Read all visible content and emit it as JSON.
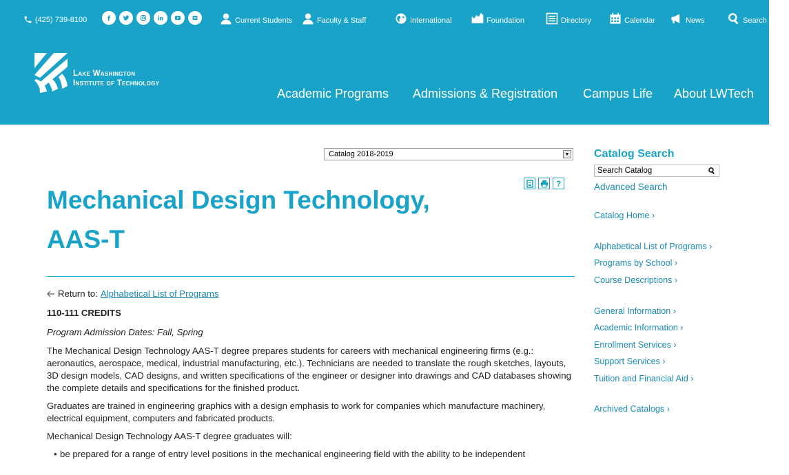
{
  "header": {
    "phone": "(425) 739-8100",
    "socials": [
      "facebook-icon",
      "twitter-icon",
      "instagram-icon",
      "linkedin-icon",
      "youtube-icon",
      "flickr-icon"
    ],
    "top_links": [
      {
        "icon": "person-icon",
        "label": "Current Students"
      },
      {
        "icon": "person-icon",
        "label": "Faculty & Staff"
      },
      {
        "icon": "globe-icon",
        "label": "International"
      },
      {
        "icon": "chart-icon",
        "label": "Foundation"
      },
      {
        "icon": "directory-icon",
        "label": "Directory"
      },
      {
        "icon": "calendar-icon",
        "label": "Calendar"
      },
      {
        "icon": "megaphone-icon",
        "label": "News"
      },
      {
        "icon": "search-icon",
        "label": "Search"
      }
    ],
    "logo_line1": "Lake Washington",
    "logo_line2": "Institute of Technology",
    "main_nav": [
      "Academic Programs",
      "Admissions & Registration",
      "Campus Life",
      "About LWTech"
    ],
    "colors": {
      "brand": "#1aa3c8",
      "link": "#1a8bb5"
    }
  },
  "catalog_select": {
    "value": "Catalog 2018-2019"
  },
  "page": {
    "title_line1": "Mechanical Design Technology,",
    "title_line2": "AAS-T",
    "return_label": "Return to:",
    "return_link": "Alphabetical List of Programs",
    "credits": "110-111 CREDITS",
    "admission_dates": "Program Admission Dates: Fall, Spring",
    "para1": "The Mechanical Design Technology AAS-T degree prepares students for careers with mechanical engineering firms (e.g.: aeronautics, aerospace, medical, industrial manufacturing, etc.). Technicians are needed to translate the rough sketches, layouts, 3D design models, CAD designs, and written specifications of the engineer or designer into drawings and CAD databases showing the complete details and specifications for the finished product.",
    "para2": "Graduates are trained in engineering graphics with a design emphasis to work for companies which manufacture machinery, electrical equipment, computers and fabricated products.",
    "para3": "Mechanical Design Technology AAS-T degree graduates will:",
    "bullets": [
      "be prepared for a range of entry level positions in the mechanical engineering field with the ability to be independent"
    ]
  },
  "sidebar": {
    "title": "Catalog Search",
    "search_placeholder": "Search Catalog",
    "advanced": "Advanced Search",
    "catalog_home": "Catalog Home ›",
    "alpha_list": "Alphabetical List of Programs ›",
    "by_school": "Programs by School ›",
    "course_desc": "Course Descriptions ›",
    "general_info": "General Information ›",
    "academic_info": "Academic Information ›",
    "enrollment": "Enrollment Services ›",
    "support": "Support Services ›",
    "tuition": "Tuition and Financial Aid ›",
    "archived": "Archived Catalogs ›"
  }
}
